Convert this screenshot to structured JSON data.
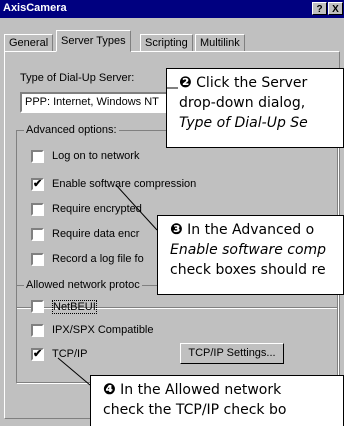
{
  "window": {
    "title": "AxisCamera",
    "help_label": "?",
    "close_label": "X"
  },
  "tabs": [
    {
      "label": "General"
    },
    {
      "label": "Server Types"
    },
    {
      "label": "Scripting"
    },
    {
      "label": "Multilink"
    }
  ],
  "dialup": {
    "label": "Type of Dial-Up Server:",
    "value": "PPP: Internet, Windows NT"
  },
  "advanced": {
    "title": "Advanced options:",
    "options": [
      {
        "label": "Log on to network",
        "checked": false
      },
      {
        "label": "Enable software compression",
        "checked": true
      },
      {
        "label": "Require encrypted",
        "checked": false
      },
      {
        "label": "Require data encr",
        "checked": false
      },
      {
        "label": "Record a log file fo",
        "checked": false
      }
    ]
  },
  "protocols": {
    "title": "Allowed network protoc",
    "options": [
      {
        "label": "NetBEUI",
        "checked": false
      },
      {
        "label": "IPX/SPX Compatible",
        "checked": false
      },
      {
        "label": "TCP/IP",
        "checked": true
      }
    ],
    "settings_button": "TCP/IP Settings..."
  },
  "callouts": [
    {
      "number": "❷",
      "lines": [
        "Click the Server",
        "drop-down dialog,",
        "Type of Dial-Up Se"
      ]
    },
    {
      "number": "❸",
      "lines": [
        "In the Advanced o",
        "Enable software comp",
        "check boxes should re"
      ]
    },
    {
      "number": "❹",
      "lines": [
        "In the Allowed network",
        "check the TCP/IP check bo"
      ]
    }
  ],
  "check_mark": "✔"
}
